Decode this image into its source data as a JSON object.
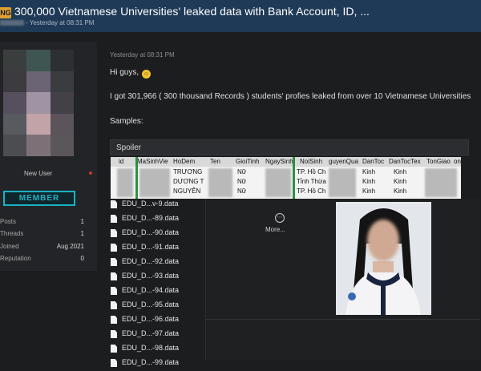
{
  "thread": {
    "prefix": "NG",
    "title": "300,000 Vietnamese Universities' leaked data with Bank Account, ID, ...",
    "meta": "- Yesterday at 08:31 PM"
  },
  "user": {
    "username": "New User",
    "rank": "MEMBER",
    "stats": [
      {
        "label": "Posts",
        "value": "1"
      },
      {
        "label": "Threads",
        "value": "1"
      },
      {
        "label": "Joined",
        "value": "Aug 2021"
      },
      {
        "label": "Reputation",
        "value": "0"
      }
    ]
  },
  "post": {
    "date": "Yesterday at 08:31 PM",
    "greeting": "Hi guys,",
    "intro": "I got 301,966 ( 300 thousand Records ) students' profies leaked from over 10 Vietnamese Universities",
    "samples_label": "Samples:",
    "spoiler_label": "Spoiler",
    "sheet": {
      "headers": [
        "id",
        "MaSinhVien",
        "HoDem",
        "Ten",
        "GioiTinh",
        "NgaySinh",
        "NoiSinh",
        "NguyenQuan",
        "DanToc",
        "DanTocTex",
        "TonGiao",
        "TonGiao"
      ],
      "header_display": [
        "id",
        "MaSinhVie",
        "HoDem",
        "Ten",
        "GioiTinh",
        "NgaySinh",
        "NoiSinh",
        "guyenQua",
        "DanToc",
        "DanTocTex",
        "TonGiao",
        "onGi"
      ],
      "rows": [
        {
          "hodem": "TRƯƠNG",
          "gioitinh": "Nữ",
          "noisinh": "TP. Hồ Ch",
          "dantoc": "Kinh",
          "dantoctex": "Kinh"
        },
        {
          "hodem": "DƯƠNG T",
          "gioitinh": "Nữ",
          "noisinh": "Tỉnh Thừa",
          "dantoc": "Kinh",
          "dantoctex": "Kinh"
        },
        {
          "hodem": "NGUYỄN",
          "gioitinh": "Nữ",
          "noisinh": "TP. Hồ Ch",
          "dantoc": "Kinh",
          "dantoctex": "Kinh"
        }
      ]
    },
    "attachments": [
      "EDU_D...v-9.data",
      "EDU_D...-89.data",
      "EDU_D...-90.data",
      "EDU_D...-91.data",
      "EDU_D...-92.data",
      "EDU_D...-93.data",
      "EDU_D...-94.data",
      "EDU_D...-95.data",
      "EDU_D...-96.data",
      "EDU_D...-97.data",
      "EDU_D...-98.data",
      "EDU_D...-99.data"
    ],
    "more_label": "More..."
  }
}
